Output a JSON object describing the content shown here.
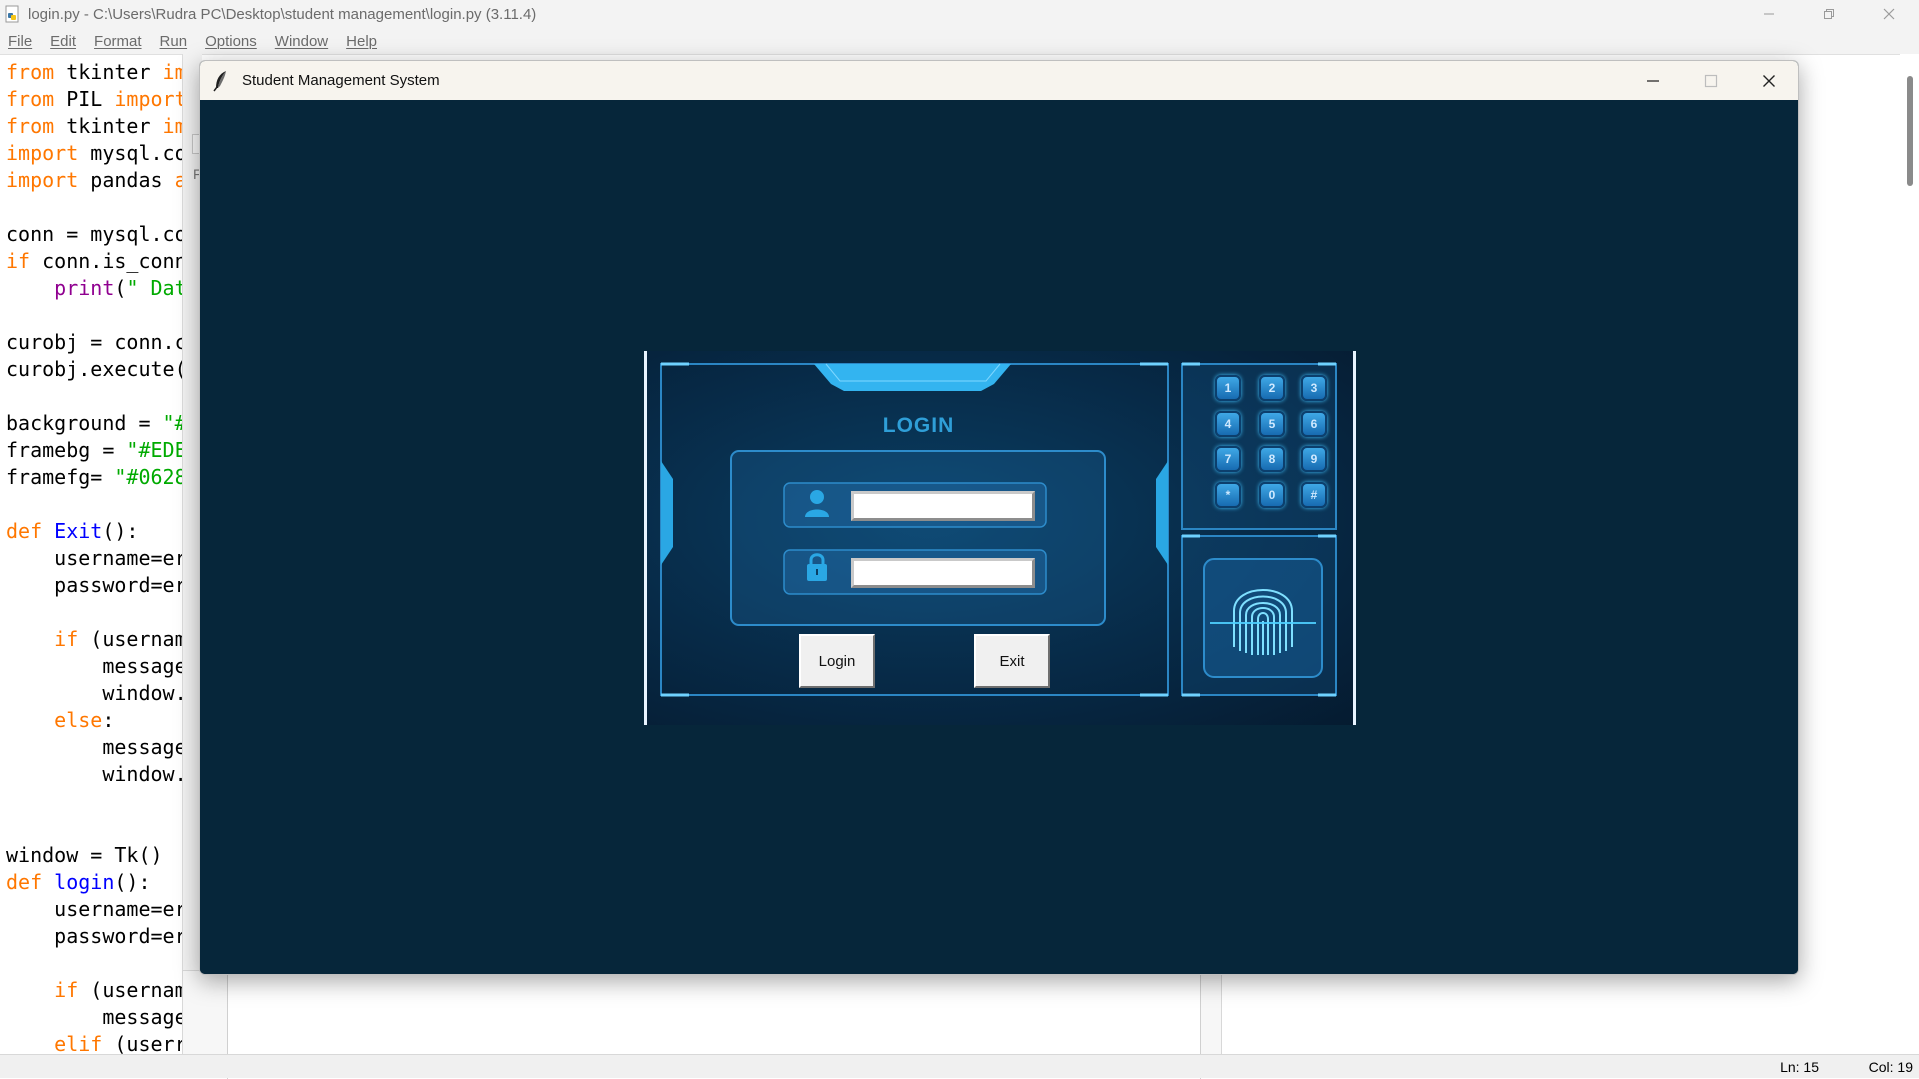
{
  "idle": {
    "title": "login.py - C:\\Users\\Rudra PC\\Desktop\\student management\\login.py (3.11.4)",
    "menu": [
      "File",
      "Edit",
      "Format",
      "Run",
      "Options",
      "Window",
      "Help"
    ],
    "status_ln": "Ln: 15",
    "status_col": "Col: 19",
    "code_lines": [
      [
        [
          "kw",
          "from"
        ],
        [
          "t",
          " tkinter "
        ],
        [
          "kw",
          "imp"
        ]
      ],
      [
        [
          "kw",
          "from"
        ],
        [
          "t",
          " PIL "
        ],
        [
          "kw",
          "import"
        ]
      ],
      [
        [
          "kw",
          "from"
        ],
        [
          "t",
          " tkinter "
        ],
        [
          "kw",
          "im"
        ]
      ],
      [
        [
          "kw",
          "import"
        ],
        [
          "t",
          " mysql.co"
        ]
      ],
      [
        [
          "kw",
          "import"
        ],
        [
          "t",
          " pandas "
        ],
        [
          "kw",
          "a"
        ]
      ],
      [],
      [
        [
          "t",
          "conn = mysql.co"
        ]
      ],
      [
        [
          "kw",
          "if"
        ],
        [
          "t",
          " conn.is_conn"
        ]
      ],
      [
        [
          "t",
          "    "
        ],
        [
          "bi",
          "print"
        ],
        [
          "t",
          "("
        ],
        [
          "str",
          "\" Dat"
        ],
        [
          "t",
          ">"
        ]
      ],
      [],
      [
        [
          "t",
          "curobj = conn.c"
        ]
      ],
      [
        [
          "t",
          "curobj.execute("
        ]
      ],
      [],
      [
        [
          "t",
          "background = "
        ],
        [
          "str",
          "\"#"
        ]
      ],
      [
        [
          "t",
          "framebg = "
        ],
        [
          "str",
          "\"#EDE"
        ]
      ],
      [
        [
          "t",
          "framefg= "
        ],
        [
          "str",
          "\"#0628"
        ]
      ],
      [],
      [
        [
          "kw",
          "def"
        ],
        [
          "t",
          " "
        ],
        [
          "def",
          "Exit"
        ],
        [
          "t",
          "():"
        ]
      ],
      [
        [
          "t",
          "    username=er"
        ]
      ],
      [
        [
          "t",
          "    password=er"
        ]
      ],
      [],
      [
        [
          "t",
          "    "
        ],
        [
          "kw",
          "if"
        ],
        [
          "t",
          " (usernam"
        ]
      ],
      [
        [
          "t",
          "        message"
        ]
      ],
      [
        [
          "t",
          "        window."
        ]
      ],
      [
        [
          "t",
          "    "
        ],
        [
          "kw",
          "else"
        ],
        [
          "t",
          ":"
        ]
      ],
      [
        [
          "t",
          "        message"
        ]
      ],
      [
        [
          "t",
          "        window."
        ]
      ],
      [],
      [],
      [
        [
          "t",
          "window = Tk()"
        ]
      ],
      [
        [
          "kw",
          "def"
        ],
        [
          "t",
          " "
        ],
        [
          "def",
          "login"
        ],
        [
          "t",
          "():"
        ]
      ],
      [
        [
          "t",
          "    username=er"
        ]
      ],
      [
        [
          "t",
          "    password=er"
        ]
      ],
      [],
      [
        [
          "t",
          "    "
        ],
        [
          "kw",
          "if"
        ],
        [
          "t",
          " (usernam"
        ]
      ],
      [
        [
          "t",
          "        message"
        ]
      ],
      [
        [
          "t",
          "    "
        ],
        [
          "kw",
          "elif"
        ],
        [
          "t",
          " (userr"
        ]
      ]
    ]
  },
  "tk_window": {
    "title": "Student Management System",
    "background": "#06263a"
  },
  "login_panel": {
    "heading": "LOGIN",
    "username_value": "",
    "password_value": "",
    "login_button": "Login",
    "exit_button": "Exit",
    "keypad": [
      "1",
      "2",
      "3",
      "4",
      "5",
      "6",
      "7",
      "8",
      "9",
      "*",
      "0",
      "#"
    ],
    "accent": "#2f9fd8"
  }
}
